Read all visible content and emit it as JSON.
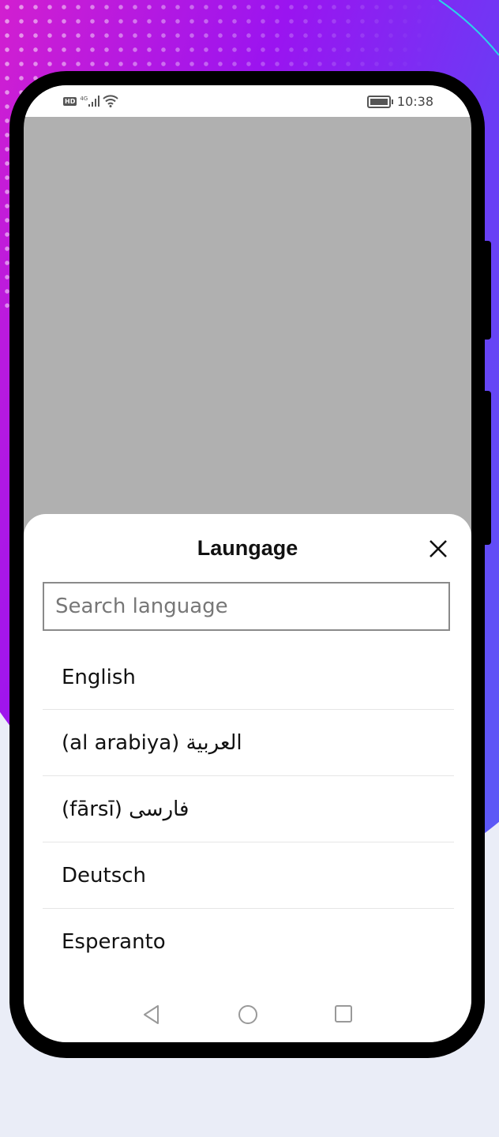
{
  "status_bar": {
    "left_badges": [
      "HD",
      "4G"
    ],
    "time": "10:38",
    "icons": [
      "hd-icon",
      "signal-icon",
      "wifi-icon",
      "battery-icon"
    ]
  },
  "sheet": {
    "title": "Laungage",
    "close_icon": "close-icon",
    "search": {
      "placeholder": "Search language",
      "value": ""
    },
    "languages": [
      "English",
      "(al arabiya) العربية",
      "(fārsī) فارسى",
      "Deutsch",
      "Esperanto"
    ]
  },
  "nav_bar": {
    "icons": [
      "back-icon",
      "home-icon",
      "recents-icon"
    ]
  },
  "colors": {
    "overlay": "#b0b0b0",
    "sheet": "#ffffff",
    "frame": "#000000",
    "background_accent": "#9a14f0"
  }
}
